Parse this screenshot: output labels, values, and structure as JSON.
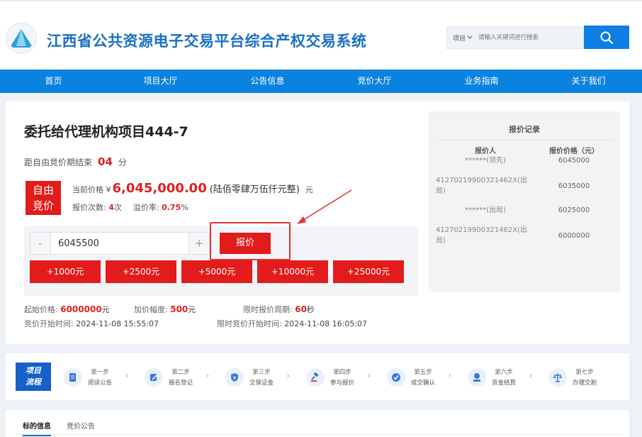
{
  "header": {
    "logo_text": "",
    "site_title": "江西省公共资源电子交易平台综合产权交易系统",
    "search_category": "项目",
    "search_placeholder": "请输入关键词进行搜索"
  },
  "nav": [
    "首页",
    "项目大厅",
    "公告信息",
    "竞价大厅",
    "业务指南",
    "关于我们"
  ],
  "project": {
    "title": "委托给代理机构项目444-7",
    "countdown_label": "距自由竞价期结束",
    "countdown_value": "04",
    "countdown_unit": "分",
    "badge_line1": "自由",
    "badge_line2": "竞价",
    "current_price_label": "当前价格 ¥",
    "current_price": "6,045,000.00",
    "current_price_cn": "(陆佰零肆万伍仟元整)",
    "price_unit": "元",
    "bid_count_label": "报价次数:",
    "bid_count": "4",
    "bid_count_unit": "次",
    "premium_label": "溢价率:",
    "premium_value": "0.75",
    "premium_unit": "%"
  },
  "bid": {
    "minus": "-",
    "plus": "+",
    "amount": "6045500",
    "submit_label": "报价",
    "quick_buttons": [
      "+1000元",
      "+2500元",
      "+5000元",
      "+10000元",
      "+25000元"
    ]
  },
  "info": {
    "start_price_label": "起始价格:",
    "start_price": "6000000",
    "start_price_unit": "元",
    "increment_label": "加价幅度:",
    "increment": "500",
    "increment_unit": "元",
    "period_label": "限时报价周期:",
    "period": "60",
    "period_unit": "秒",
    "start_time_label": "竞价开始时间:",
    "start_time": "2024-11-08 15:55:07",
    "timed_start_label": "限时竞价开始时间:",
    "timed_start": "2024-11-08 16:05:07"
  },
  "records": {
    "title": "报价记录",
    "col_bidder": "报价人",
    "col_price": "报价价格（元）",
    "rows": [
      {
        "bidder": "******(领先)",
        "price": "6045000"
      },
      {
        "bidder": "41270219900321462X(出局)",
        "price": "6035000"
      },
      {
        "bidder": "******(出局)",
        "price": "6025000"
      },
      {
        "bidder": "41270219900321462X(出局)",
        "price": "6000000"
      }
    ]
  },
  "flow": {
    "badge_line1": "项目",
    "badge_line2": "流程",
    "steps": [
      {
        "step": "第一步",
        "name": "阅读公告",
        "icon": "document-icon"
      },
      {
        "step": "第二步",
        "name": "报名登记",
        "icon": "edit-icon"
      },
      {
        "step": "第三步",
        "name": "交保证金",
        "icon": "shield-yen-icon"
      },
      {
        "step": "第四步",
        "name": "参与报价",
        "icon": "gavel-icon"
      },
      {
        "step": "第五步",
        "name": "成交确认",
        "icon": "check-icon"
      },
      {
        "step": "第六步",
        "name": "资金结算",
        "icon": "money-icon"
      },
      {
        "step": "第七步",
        "name": "办理交割",
        "icon": "scale-icon"
      }
    ]
  },
  "tabs": [
    "标的信息",
    "竞价公告"
  ],
  "colors": {
    "primary_blue": "#0a82e0",
    "accent_red": "#e21b1b",
    "title_blue": "#1a6fc4"
  }
}
